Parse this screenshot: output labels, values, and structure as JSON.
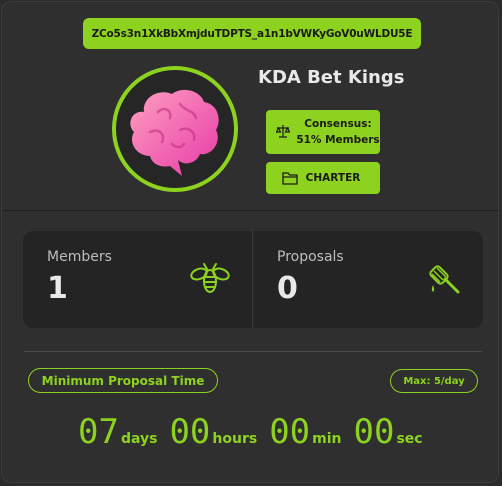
{
  "header": {
    "address": "ZCo5s3n1XkBbXmjduTDPTS_a1n1bVWKyGoV0uWLDU5E",
    "title": "KDA Bet Kings"
  },
  "avatar": {
    "icon": "brain-icon"
  },
  "consensus": {
    "line1": "Consensus:",
    "line2": "51% Members",
    "icon": "scales-icon"
  },
  "charter": {
    "label": "CHARTER",
    "icon": "folder-icon"
  },
  "stats": {
    "members": {
      "label": "Members",
      "value": "1",
      "icon": "bee-icon"
    },
    "proposals": {
      "label": "Proposals",
      "value": "0",
      "icon": "honey-dipper-icon"
    }
  },
  "proposal_time": {
    "label": "Minimum Proposal Time",
    "max": "Max: 5/day",
    "days": "07",
    "days_unit": "days",
    "hours": "00",
    "hours_unit": "hours",
    "min": "00",
    "min_unit": "min",
    "sec": "00",
    "sec_unit": "sec"
  },
  "colors": {
    "accent": "#8dd21f",
    "background": "#2f2f2f",
    "panel": "#242424"
  }
}
